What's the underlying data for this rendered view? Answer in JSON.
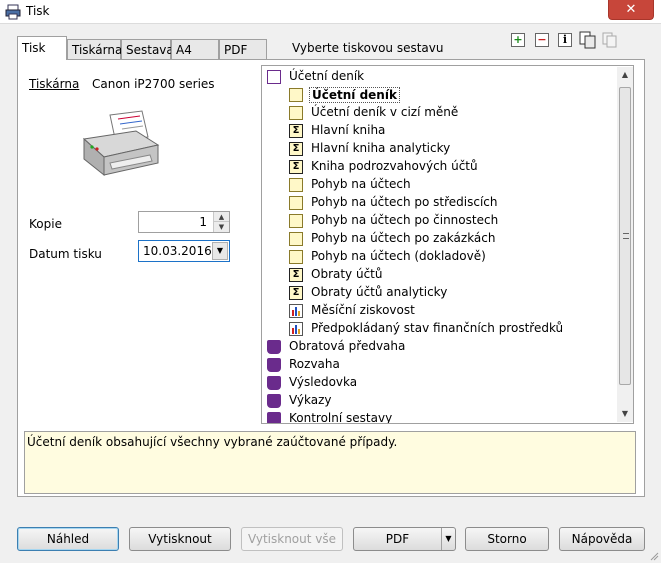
{
  "window": {
    "title": "Tisk",
    "close_label": "✕"
  },
  "tabs": [
    {
      "label": "Tisk",
      "active": true
    },
    {
      "label": "Tiskárna",
      "active": false
    },
    {
      "label": "Sestava",
      "active": false
    },
    {
      "label": "A4",
      "active": false
    },
    {
      "label": "PDF",
      "active": false
    }
  ],
  "tab_hint": "Vyberte tiskovou sestavu",
  "toolbar": {
    "expand_icon": "+",
    "collapse_icon": "−",
    "info_icon": "i",
    "copy_icon": "copy",
    "paste_icon": "paste"
  },
  "printer": {
    "link_label": "Tiskárna",
    "name": "Canon iP2700 series"
  },
  "copies": {
    "label": "Kopie",
    "value": "1"
  },
  "print_date": {
    "label": "Datum tisku",
    "value": "10.03.2016"
  },
  "tree": {
    "items": [
      {
        "label": "Účetní deník",
        "icon": "book-open",
        "level": 0
      },
      {
        "label": "Účetní deník",
        "icon": "page",
        "level": 1,
        "selected": true
      },
      {
        "label": "Účetní deník v cizí měně",
        "icon": "page",
        "level": 1
      },
      {
        "label": "Hlavní kniha",
        "icon": "sum",
        "level": 1
      },
      {
        "label": "Hlavní kniha analyticky",
        "icon": "sum",
        "level": 1
      },
      {
        "label": "Kniha podrozvahových účtů",
        "icon": "sum",
        "level": 1
      },
      {
        "label": "Pohyb na účtech",
        "icon": "page",
        "level": 1
      },
      {
        "label": "Pohyb na účtech po střediscích",
        "icon": "page",
        "level": 1
      },
      {
        "label": "Pohyb na účtech po činnostech",
        "icon": "page",
        "level": 1
      },
      {
        "label": "Pohyb na účtech po zakázkách",
        "icon": "page",
        "level": 1
      },
      {
        "label": "Pohyb na účtech (dokladově)",
        "icon": "page",
        "level": 1
      },
      {
        "label": "Obraty účtů",
        "icon": "sum",
        "level": 1
      },
      {
        "label": "Obraty účtů analyticky",
        "icon": "sum",
        "level": 1
      },
      {
        "label": "Měsíční ziskovost",
        "icon": "chart",
        "level": 1
      },
      {
        "label": "Předpokládaný stav finančních prostředků",
        "icon": "chart",
        "level": 1
      },
      {
        "label": "Obratová předvaha",
        "icon": "book",
        "level": 0
      },
      {
        "label": "Rozvaha",
        "icon": "book",
        "level": 0
      },
      {
        "label": "Výsledovka",
        "icon": "book",
        "level": 0
      },
      {
        "label": "Výkazy",
        "icon": "book",
        "level": 0
      },
      {
        "label": "Kontrolní sestavy",
        "icon": "book",
        "level": 0
      }
    ]
  },
  "description": "Účetní deník obsahující všechny vybrané zaúčtované případy.",
  "buttons": {
    "preview": "Náhled",
    "print": "Vytisknout",
    "print_all": "Vytisknout vše",
    "pdf": "PDF",
    "cancel": "Storno",
    "help": "Nápověda"
  },
  "colors": {
    "selected_border": "#3c7fb1",
    "description_bg": "#fffce0",
    "close_red": "#c7463a"
  }
}
